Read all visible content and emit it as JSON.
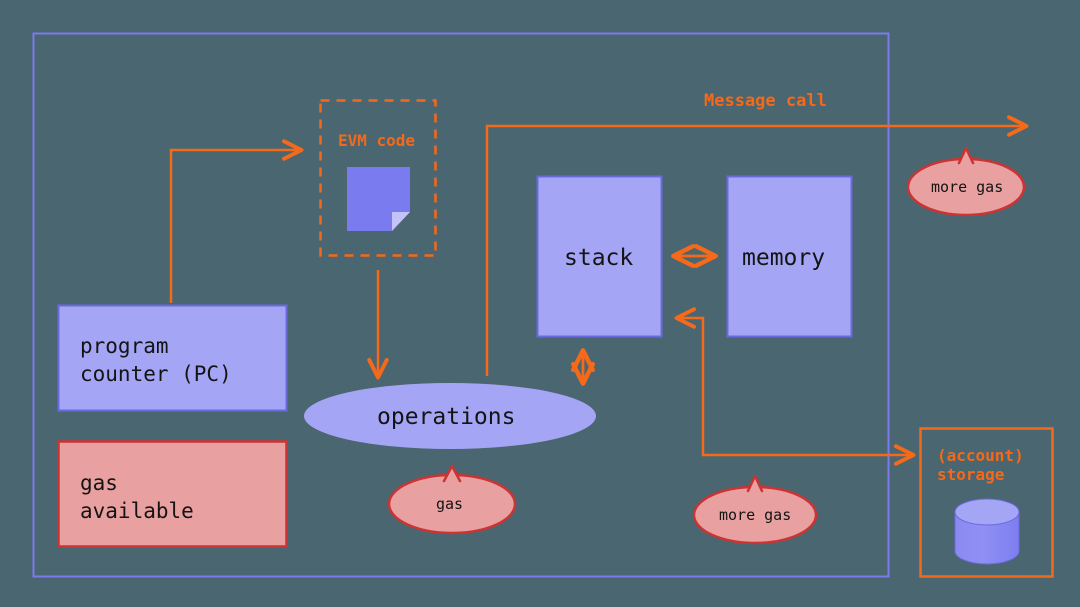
{
  "diagram": {
    "title_text": "Message call",
    "colors": {
      "background": "#4a6670",
      "outer_border": "#7b7bee",
      "purple_fill": "#a5a5f5",
      "purple_border": "#6a6ae0",
      "pink_fill": "#e8a0a0",
      "pink_border": "#cc3333",
      "orange": "#f4691a",
      "text_dark": "#141414"
    },
    "nodes": {
      "evm_code": {
        "label": "EVM code",
        "style": "dashed-orange-box-with-document-icon"
      },
      "program_counter": {
        "label_line1": "program",
        "label_line2": "counter (PC)",
        "style": "purple-box"
      },
      "gas_available": {
        "label_line1": "gas",
        "label_line2": "available",
        "style": "pink-box"
      },
      "operations": {
        "label": "operations",
        "style": "purple-ellipse"
      },
      "gas": {
        "label": "gas",
        "style": "pink-callout-ellipse"
      },
      "stack": {
        "label": "stack",
        "style": "purple-box"
      },
      "memory": {
        "label": "memory",
        "style": "purple-box"
      },
      "more_gas_top": {
        "label": "more gas",
        "style": "pink-callout-ellipse"
      },
      "more_gas_bottom": {
        "label": "more gas",
        "style": "pink-callout-ellipse"
      },
      "account_storage": {
        "label_line1": "(account)",
        "label_line2": "storage",
        "style": "orange-box-with-database-icon"
      }
    },
    "edges": [
      {
        "name": "pc-to-evm-code",
        "from": "program_counter",
        "to": "evm_code",
        "arrow": "single"
      },
      {
        "name": "evm-code-to-operations",
        "from": "evm_code",
        "to": "operations",
        "arrow": "single"
      },
      {
        "name": "operations-to-message-call",
        "from": "operations",
        "to": "external",
        "arrow": "single",
        "label": "Message call"
      },
      {
        "name": "stack-memory",
        "from": "stack",
        "to": "memory",
        "arrow": "double"
      },
      {
        "name": "stack-operations",
        "from": "stack",
        "to": "operations",
        "arrow": "double"
      },
      {
        "name": "storage-to-stack",
        "from": "account_storage",
        "to": "stack",
        "arrow": "double-ended-path"
      }
    ]
  }
}
